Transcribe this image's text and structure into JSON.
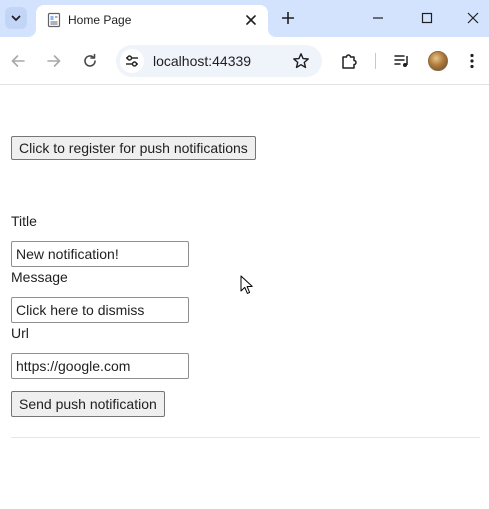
{
  "browser": {
    "tab": {
      "title": "Home Page"
    },
    "address_bar": {
      "url": "localhost:44339"
    }
  },
  "page": {
    "register_button_label": "Click to register for push notifications",
    "fields": [
      {
        "label": "Title",
        "value": "New notification!"
      },
      {
        "label": "Message",
        "value": "Click here to dismiss"
      },
      {
        "label": "Url",
        "value": "https://google.com"
      }
    ],
    "send_button_label": "Send push notification"
  },
  "icons": {
    "tab_search": "chevron-down-icon",
    "favicon": "page-icon",
    "tab_close": "close-icon",
    "new_tab": "plus-icon",
    "minimize": "minimize-icon",
    "maximize": "maximize-icon",
    "close_window": "close-icon",
    "back": "arrow-left-icon",
    "forward": "arrow-right-icon",
    "reload": "reload-icon",
    "site_info": "tune-icon",
    "bookmark": "star-icon",
    "extensions": "puzzle-icon",
    "media": "playlist-icon",
    "menu": "more-vert-icon",
    "cursor": "mouse-pointer-icon"
  },
  "colors": {
    "tabstrip_bg": "#d3e3fd",
    "omnibox_bg": "#eff3fa",
    "button_bg": "#efefef"
  }
}
